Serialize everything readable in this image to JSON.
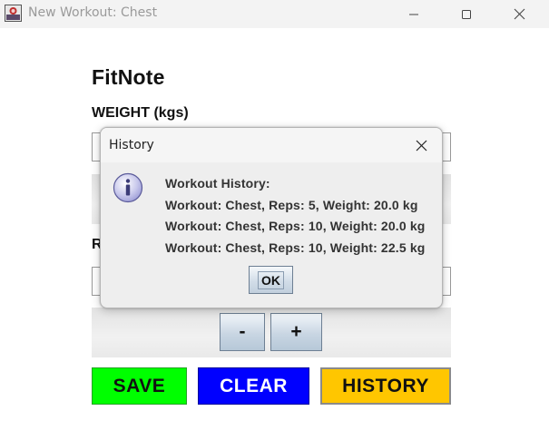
{
  "window": {
    "title": "New Workout: Chest"
  },
  "app": {
    "title": "FitNote",
    "weight_label": "WEIGHT (kgs)",
    "reps_label_partial": "R",
    "reps_minus": "-",
    "reps_plus": "+"
  },
  "actions": {
    "save": "SAVE",
    "clear": "CLEAR",
    "history": "HISTORY"
  },
  "dialog": {
    "title": "History",
    "heading": "Workout History:",
    "entries": [
      "Workout: Chest, Reps: 5, Weight: 20.0 kg",
      "Workout: Chest, Reps: 10, Weight: 20.0 kg",
      "Workout: Chest, Reps: 10, Weight: 22.5 kg"
    ],
    "ok": "OK"
  },
  "icons": {
    "app": "app-icon",
    "minimize": "minimize-icon",
    "maximize": "maximize-icon",
    "close": "close-icon",
    "info": "info-icon"
  },
  "colors": {
    "save": "#00ff00",
    "clear": "#0000ff",
    "history": "#ffc600"
  }
}
